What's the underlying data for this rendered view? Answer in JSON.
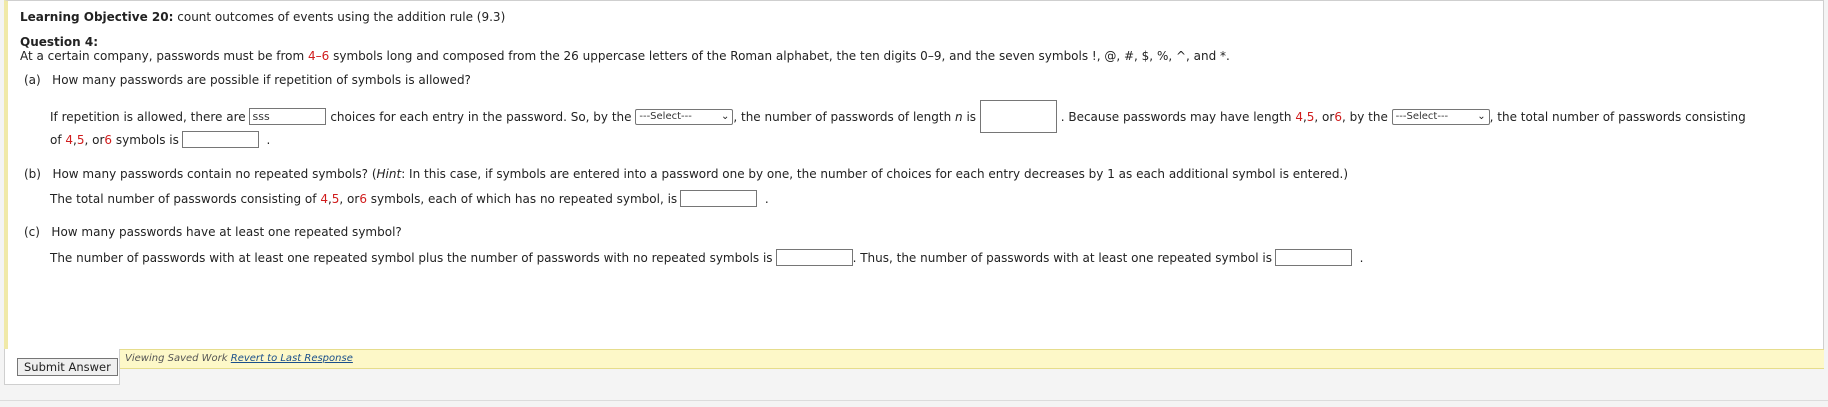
{
  "objective": {
    "label": "Learning Objective 20:",
    "text": "count outcomes of events using the addition rule (9.3)"
  },
  "question": {
    "label": "Question 4:",
    "intro_a": "At a certain company, passwords must be from ",
    "range_low": "4",
    "range_dash": "–",
    "range_high": "6",
    "intro_b": " symbols long and composed from the 26 uppercase letters of the Roman alphabet, the ten digits 0–9, and the seven symbols !, @, #, $, %, ^, and *."
  },
  "part_a": {
    "marker": "(a)",
    "question": "How many passwords are possible if repetition of symbols is allowed?",
    "t1": "If repetition is allowed, there are",
    "input_choices_value": "sss",
    "t2": "choices for each entry in the password. So, by the",
    "select1_value": "---Select---",
    "t3": ", the number of passwords of length",
    "var_n": "n",
    "t4": "is",
    "t5": ". Because passwords may have length",
    "len1": "4",
    "sep1": ", ",
    "len2": "5",
    "sep2": ", or ",
    "len3": "6",
    "t6": ", by the",
    "select2_value": "---Select---",
    "t7": ", the total number of passwords consisting",
    "t8": "of",
    "t9": "symbols is",
    "end": "."
  },
  "part_b": {
    "marker": "(b)",
    "q1": "How many passwords contain no repeated symbols? (",
    "hint_label": "Hint",
    "q2": ": In this case, if symbols are entered into a password one by one, the number of choices for each entry decreases by 1 as each additional symbol is entered.)",
    "t1": "The total number of passwords consisting of",
    "t2": "symbols, each of which has no repeated symbol, is",
    "end": "."
  },
  "part_c": {
    "marker": "(c)",
    "question": "How many passwords have at least one repeated symbol?",
    "t1": "The number of passwords with at least one repeated symbol plus the number of passwords with no repeated symbols is",
    "t2": ". Thus, the number of passwords with at least one repeated symbol is",
    "end": "."
  },
  "footer": {
    "submit_label": "Submit Answer",
    "saved_text": "Viewing Saved Work",
    "revert_link": "Revert to Last Response"
  }
}
